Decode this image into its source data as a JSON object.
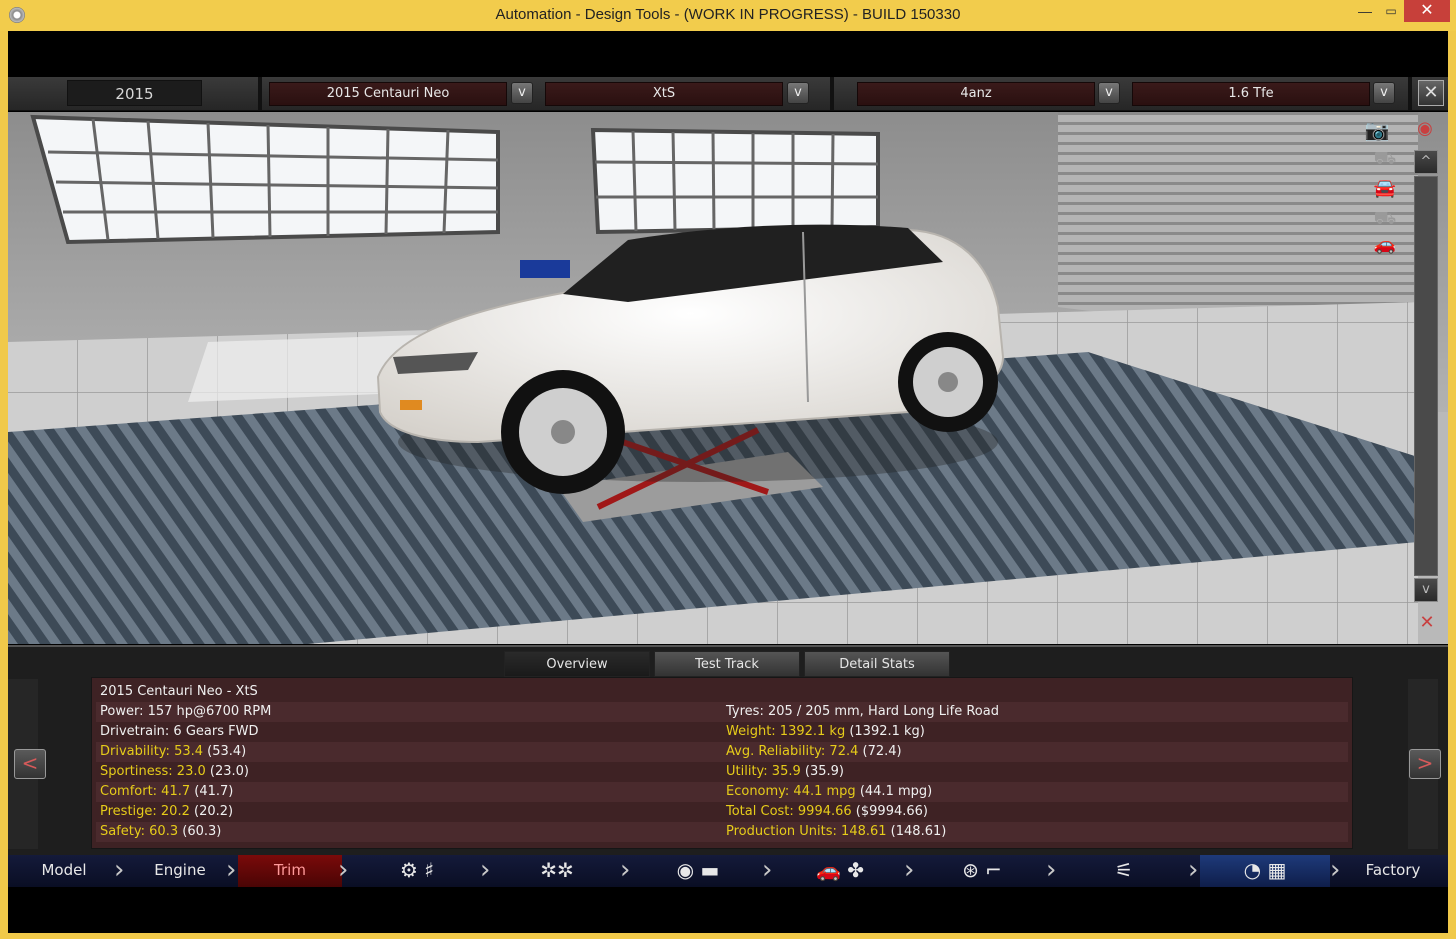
{
  "window": {
    "title": "Automation - Design Tools - (WORK IN PROGRESS) - BUILD 150330",
    "controls": {
      "minimize": "—",
      "maximize": "▭",
      "close": "✕"
    }
  },
  "topbar": {
    "year": "2015",
    "model": "2015 Centauri Neo",
    "trim": "XtS",
    "engine_family": "4anz",
    "engine_variant": "1.6 Tfe",
    "dropdown_glyph": "v",
    "close_glyph": "✕"
  },
  "camera_tools": {
    "up_glyph": "^",
    "down_glyph": "v"
  },
  "panel": {
    "tabs": [
      "Overview",
      "Test Track",
      "Detail Stats"
    ],
    "active_tab": "Overview",
    "prev_glyph": "<",
    "next_glyph": ">",
    "rows": [
      {
        "left": "2015 Centauri Neo - XtS",
        "right": ""
      },
      {
        "left": "Power: 157 hp@6700 RPM",
        "right": "Tyres: 205 / 205 mm, Hard Long Life Road"
      },
      {
        "left": "Drivetrain: 6 Gears FWD",
        "right_key": "Weight: 1392.1 kg",
        "right_val": " (1392.1 kg)"
      },
      {
        "left_key": "Drivability: 53.4",
        "left_val": " (53.4)",
        "right_key": "Avg. Reliability: 72.4",
        "right_val": " (72.4)"
      },
      {
        "left_key": "Sportiness: 23.0",
        "left_val": " (23.0)",
        "right_key": "Utility: 35.9",
        "right_val": " (35.9)"
      },
      {
        "left_key": "Comfort: 41.7",
        "left_val": " (41.7)",
        "right_key": "Economy: 44.1 mpg",
        "right_val": " (44.1 mpg)"
      },
      {
        "left_key": "Prestige: 20.2",
        "left_val": " (20.2)",
        "right_key": "Total Cost: 9994.66",
        "right_val": " ($9994.66)"
      },
      {
        "left_key": "Safety: 60.3",
        "left_val": " (60.3)",
        "right_key": "Production Units: 148.61",
        "right_val": " (148.61)"
      }
    ]
  },
  "bottomnav": {
    "model": "Model",
    "engine": "Engine",
    "trim": "Trim",
    "factory": "Factory",
    "chevron": "›"
  },
  "colors": {
    "titlebar": "#f2cc4c",
    "stat_highlight": "#e6cc1a",
    "panel_bg": "#3e2224",
    "nav_bg": "#141a3a",
    "active_trim": "#7a0a0a"
  }
}
